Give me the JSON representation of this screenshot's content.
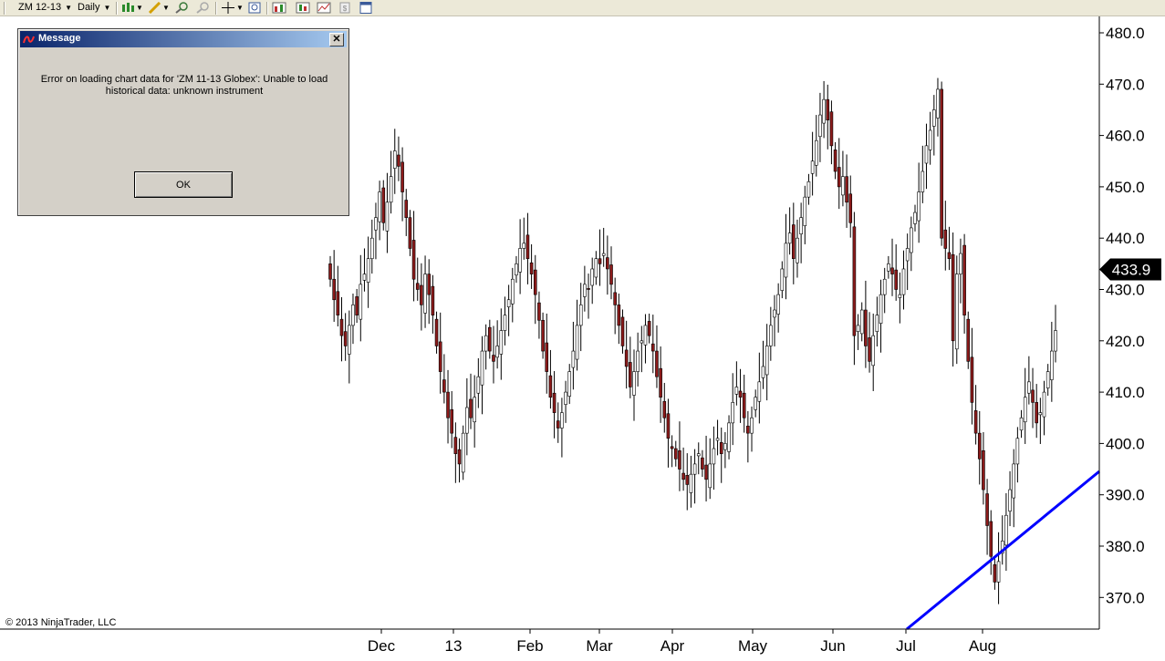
{
  "toolbar": {
    "instrument": "ZM 12-13",
    "interval": "Daily",
    "icons": [
      "bar-chart-style-icon",
      "drawing-tools-icon",
      "zoom-in-icon",
      "zoom-out-icon",
      "crosshair-icon",
      "find-icon",
      "indicators-icon",
      "strategies-icon",
      "chart-trader-icon",
      "properties-icon"
    ]
  },
  "dialog": {
    "title": "Message",
    "close_label": "✕",
    "message_line1": "Error on loading chart data for 'ZM 11-13 Globex': Unable to load",
    "message_line2": "historical data: unknown instrument",
    "ok_label": "OK"
  },
  "copyright": "© 2013 NinjaTrader, LLC",
  "colors": {
    "up": "#ffffff",
    "down": "#8b1a1a",
    "trendline": "#0000ff",
    "last_price_bg": "#000000"
  },
  "chart_data": {
    "type": "candlestick",
    "y_ticks": [
      "480.0",
      "470.0",
      "460.0",
      "450.0",
      "440.0",
      "430.0",
      "420.0",
      "410.0",
      "400.0",
      "390.0",
      "380.0",
      "370.0"
    ],
    "x_labels": [
      "Dec",
      "13",
      "Feb",
      "Mar",
      "Apr",
      "May",
      "Jun",
      "Jul",
      "Aug"
    ],
    "ylim": [
      363,
      483
    ],
    "last_price": "433.9",
    "closes": [
      432,
      428,
      425,
      421,
      419,
      423,
      427,
      425,
      431,
      433,
      436,
      440,
      444,
      449,
      443,
      447,
      452,
      457,
      454,
      449,
      444,
      438,
      432,
      430,
      427,
      433,
      429,
      425,
      419,
      414,
      410,
      405,
      402,
      398,
      396,
      402,
      407,
      405,
      409,
      413,
      418,
      421,
      418,
      416,
      419,
      422,
      425,
      428,
      432,
      435,
      438,
      439,
      436,
      433,
      429,
      424,
      418,
      414,
      409,
      406,
      403,
      406,
      410,
      414,
      418,
      423,
      427,
      431,
      430,
      434,
      436,
      435,
      437,
      434,
      431,
      427,
      423,
      419,
      415,
      411,
      414,
      418,
      420,
      423,
      421,
      418,
      413,
      409,
      405,
      401,
      399,
      397,
      395,
      393,
      392,
      394,
      396,
      398,
      395,
      393,
      396,
      399,
      401,
      398,
      400,
      404,
      408,
      411,
      409,
      405,
      402,
      405,
      409,
      412,
      415,
      419,
      423,
      426,
      429,
      434,
      439,
      441,
      436,
      440,
      444,
      448,
      451,
      455,
      459,
      464,
      467,
      463,
      458,
      453,
      450,
      452,
      447,
      443,
      421,
      423,
      426,
      419,
      416,
      421,
      425,
      429,
      432,
      435,
      433,
      430,
      429,
      434,
      438,
      442,
      445,
      449,
      453,
      458,
      461,
      465,
      469,
      440,
      438,
      436,
      420,
      433,
      437,
      425,
      416,
      408,
      402,
      397,
      391,
      384,
      378,
      373,
      377,
      381,
      386,
      391,
      396,
      401,
      405,
      409,
      412,
      408,
      404,
      406,
      410,
      414,
      418,
      422
    ]
  },
  "trendline": {
    "from": [
      994,
      690
    ],
    "to": [
      1205,
      517
    ]
  }
}
